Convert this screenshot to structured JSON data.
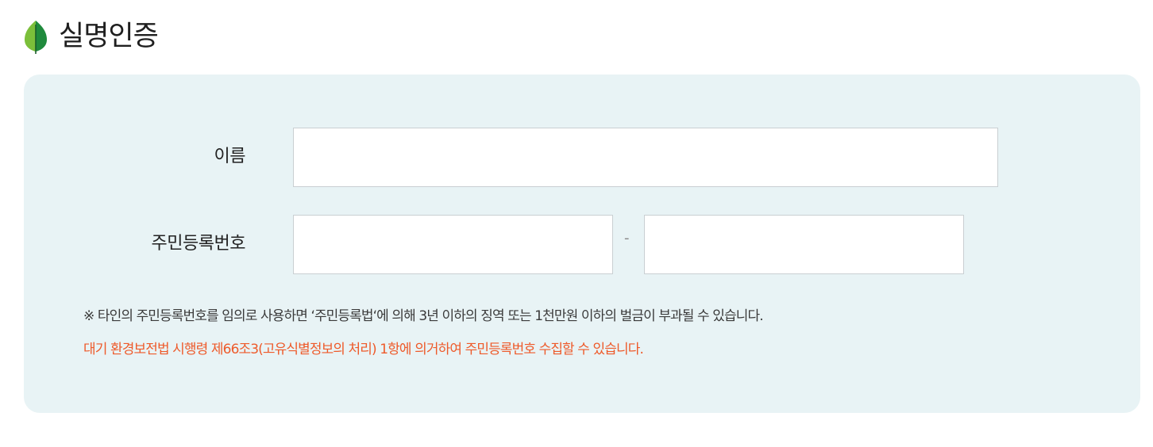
{
  "header": {
    "title": "실명인증",
    "icon": "leaf-icon",
    "icon_colors": {
      "left": "#7bbf3a",
      "right": "#1f8a3c"
    }
  },
  "form": {
    "name_label": "이름",
    "name_value": "",
    "rrn_label": "주민등록번호",
    "rrn_separator": "-",
    "rrn_front_value": "",
    "rrn_back_value": ""
  },
  "notice": {
    "warning": "※ 타인의 주민등록번호를 임의로 사용하면 ‘주민등록법‘에 의해 3년 이하의 징역 또는 1천만원 이하의 벌금이 부과될 수 있습니다.",
    "legal_basis": "대기 환경보전법 시행령 제66조3(고유식별정보의 처리) 1항에 의거하여 주민등록번호 수집할 수 있습니다.",
    "legal_color": "#ee5a2a"
  },
  "colors": {
    "panel_background": "#e8f3f5"
  }
}
